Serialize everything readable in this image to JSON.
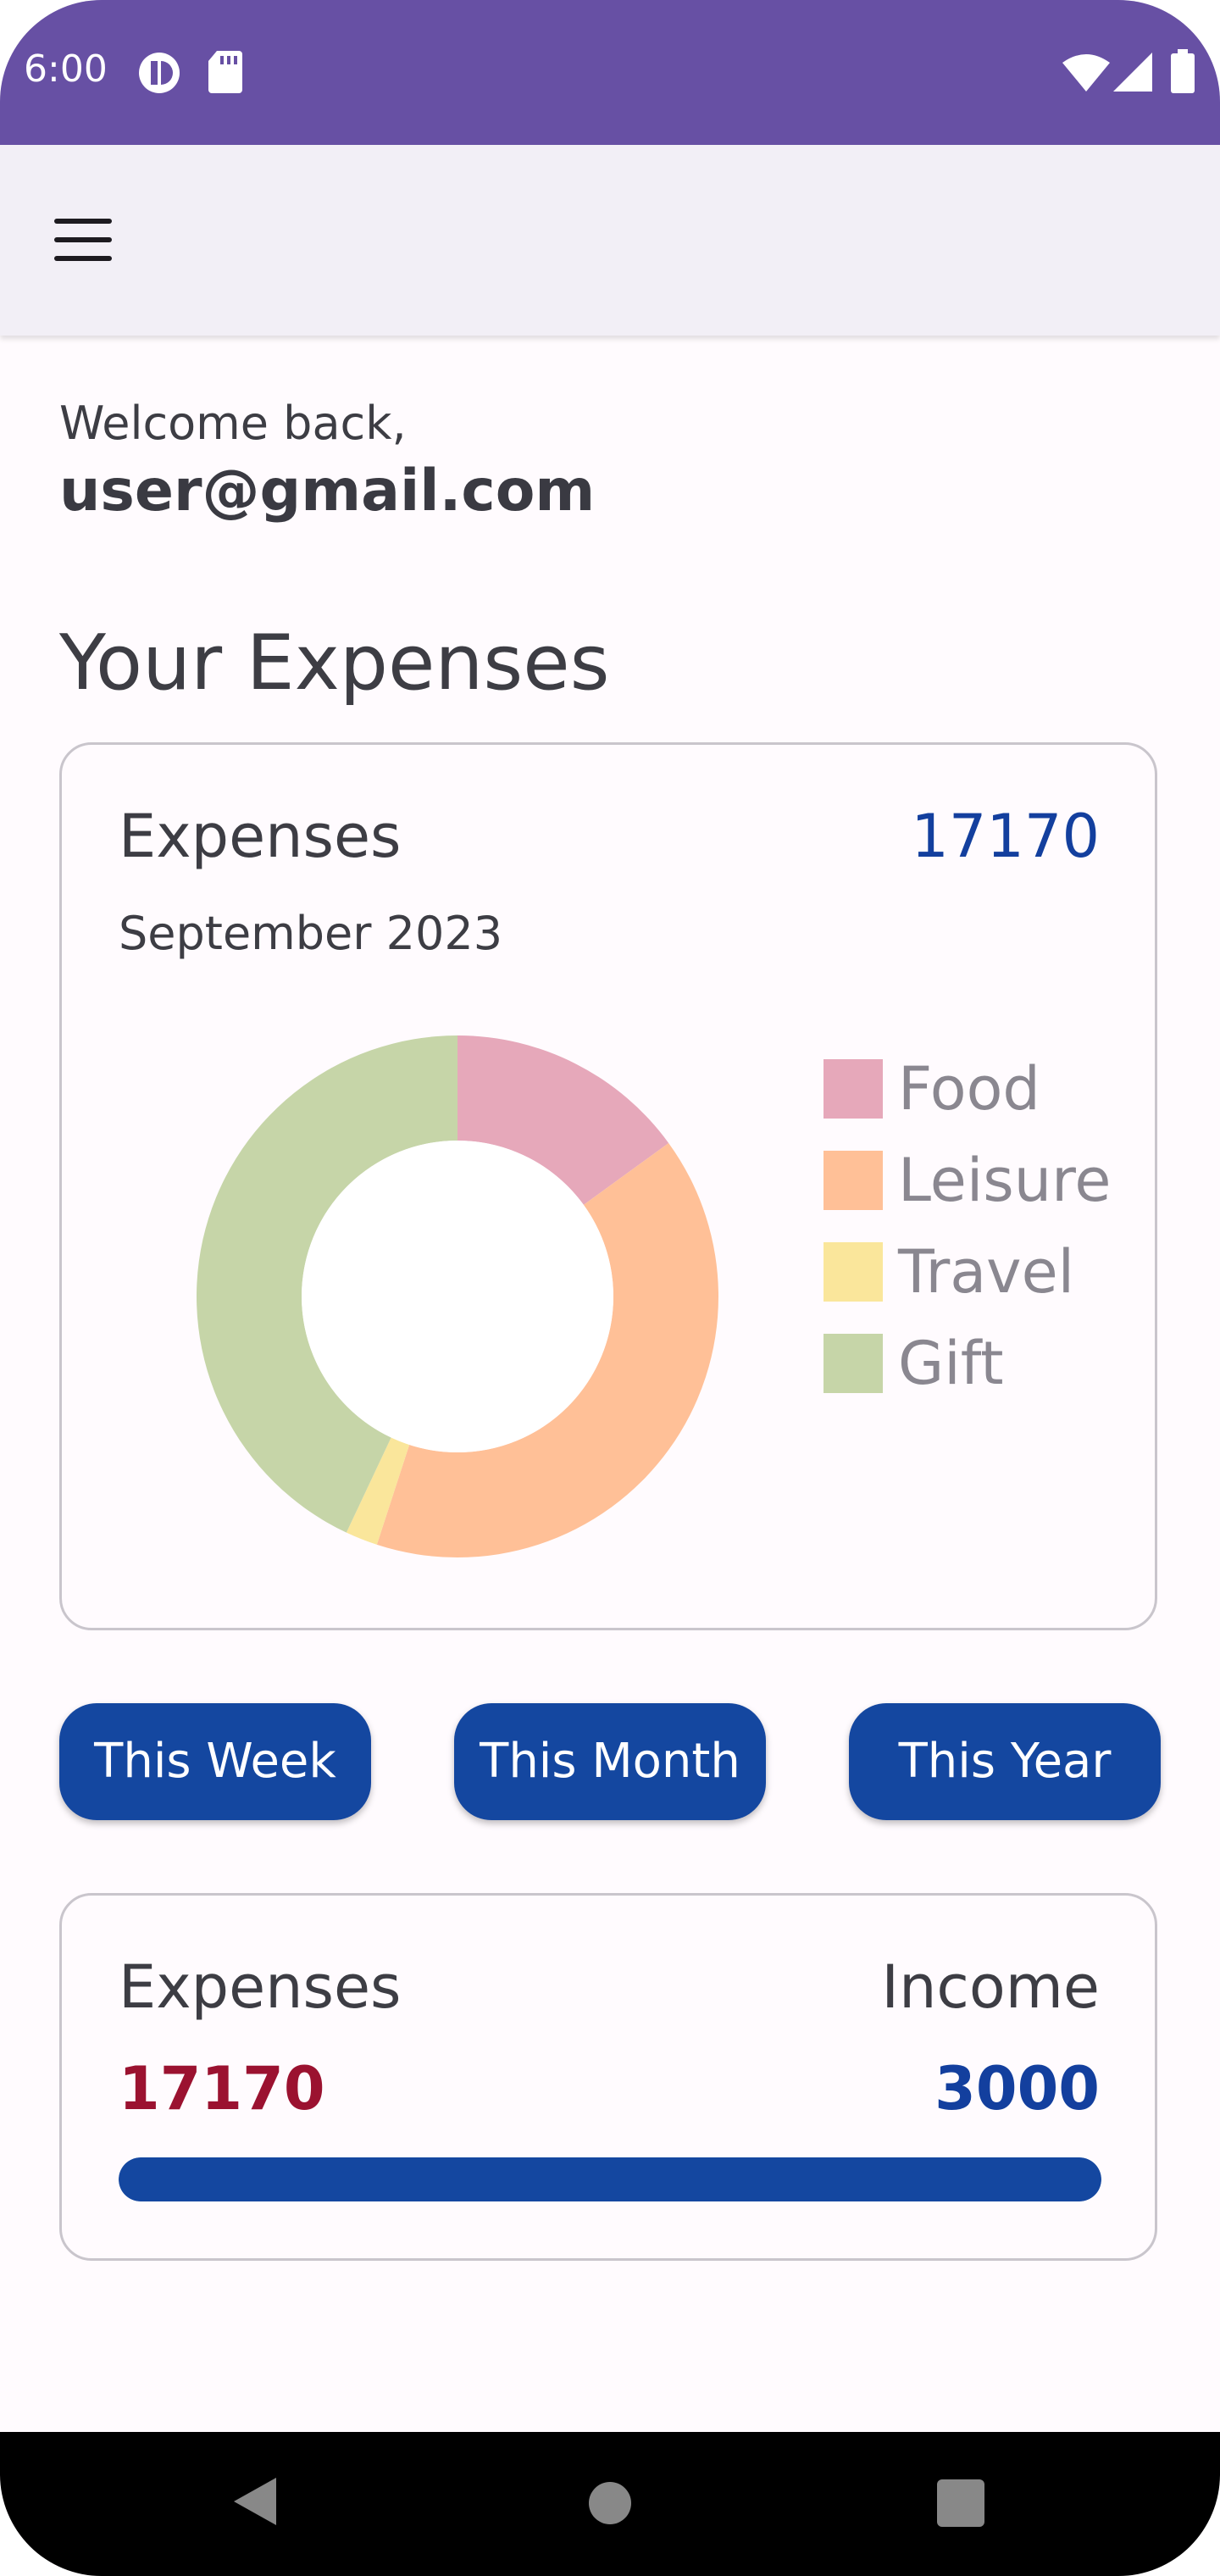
{
  "status_bar": {
    "time": "6:00"
  },
  "header": {
    "menu_icon": "hamburger-menu-icon"
  },
  "welcome": {
    "greeting": "Welcome back,",
    "email": "user@gmail.com"
  },
  "section_title": "Your Expenses",
  "expense_card": {
    "label": "Expenses",
    "total": "17170",
    "period": "September 2023"
  },
  "chart_data": {
    "type": "pie",
    "categories": [
      "Food",
      "Leisure",
      "Travel",
      "Gift"
    ],
    "values": [
      15,
      40,
      2,
      43
    ],
    "colors": [
      "#e6a8ba",
      "#ffc097",
      "#fae69b",
      "#c6d5a8"
    ],
    "donut": true,
    "legend_position": "right"
  },
  "filters": [
    {
      "label": "This Week"
    },
    {
      "label": "This Month"
    },
    {
      "label": "This Year"
    }
  ],
  "summary_card": {
    "expenses_label": "Expenses",
    "income_label": "Income",
    "expenses_value": "17170",
    "income_value": "3000",
    "progress_percent": 100
  },
  "colors": {
    "status_bar": "#6750a4",
    "app_bar": "#f2eff6",
    "accent": "#1447a0",
    "expense_red": "#9b1230"
  }
}
